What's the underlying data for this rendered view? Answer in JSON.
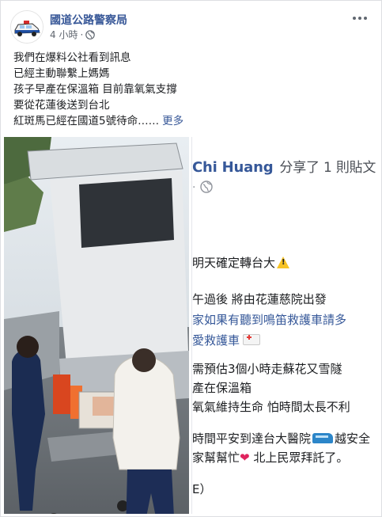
{
  "post": {
    "page_name": "國道公路警察局",
    "time": "4 小時",
    "dot": "·",
    "text_lines": [
      "我們在爆料公社看到訊息",
      "已經主動聯繫上媽媽",
      "孩子早產在保溫箱 目前靠氧氣支撐",
      "要從花蓮後送到台北",
      "紅斑馬已經在國道5號待命……"
    ],
    "see_more": "更多"
  },
  "shared": {
    "name": "Chi Huang",
    "action": "分享了 1 則貼文",
    "dot": "·",
    "lines": [
      "明天確定轉台大",
      "午過後 將由花蓮慈院出發",
      "家如果有聽到鳴笛救護車請多",
      "愛救護車",
      "需預估3個小時走蘇花又雪隧",
      "產在保溫箱",
      "氧氣維持生命 怕時間太長不利",
      "時間平安到達台大醫院",
      "越安全",
      "家幫幫忙",
      "北上民眾拜託了。",
      "E）"
    ]
  },
  "colors": {
    "link": "#385898",
    "meta": "#606770",
    "text": "#1c1e21"
  }
}
